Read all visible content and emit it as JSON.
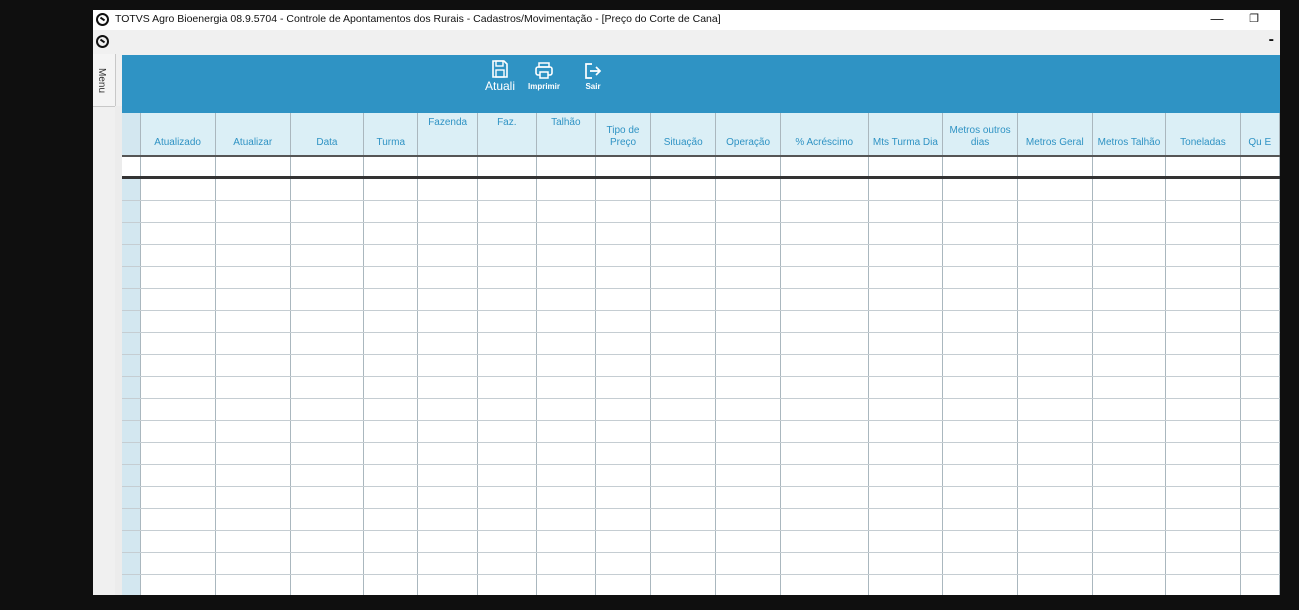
{
  "window": {
    "title": "TOTVS Agro Bioenergia 08.9.5704 - Controle de Apontamentos dos Rurais - Cadastros/Movimentação - [Preço do Corte de Cana]",
    "minimize_glyph": "—",
    "restore_glyph": "❐",
    "mdi_minimize_glyph": "-"
  },
  "side_menu": {
    "label": "Menu"
  },
  "toolbar": {
    "save_label": "Atuali",
    "print_label": "Imprimir",
    "exit_label": "Sair"
  },
  "grid": {
    "columns": [
      {
        "label": "Atualizado",
        "top": false
      },
      {
        "label": "Atualizar",
        "top": false
      },
      {
        "label": "Data",
        "top": false
      },
      {
        "label": "Turma",
        "top": false
      },
      {
        "label": "Fazenda",
        "top": true
      },
      {
        "label": "Faz.",
        "top": true
      },
      {
        "label": "Talhão",
        "top": true
      },
      {
        "label": "Tipo de Preço",
        "top": false
      },
      {
        "label": "Situação",
        "top": false
      },
      {
        "label": "Operação",
        "top": false
      },
      {
        "label": "% Acréscimo",
        "top": false
      },
      {
        "label": "Mts Turma Dia",
        "top": false
      },
      {
        "label": "Metros outros dias",
        "top": false
      },
      {
        "label": "Metros Geral",
        "top": false
      },
      {
        "label": "Metros Talhão",
        "top": false
      },
      {
        "label": "Toneladas",
        "top": false
      },
      {
        "label": "Qu E",
        "top": false
      }
    ],
    "empty_rows": 20
  },
  "colors": {
    "toolbar": "#2f93c4",
    "header_bg": "#dbeff6",
    "header_text": "#2f93c4"
  }
}
